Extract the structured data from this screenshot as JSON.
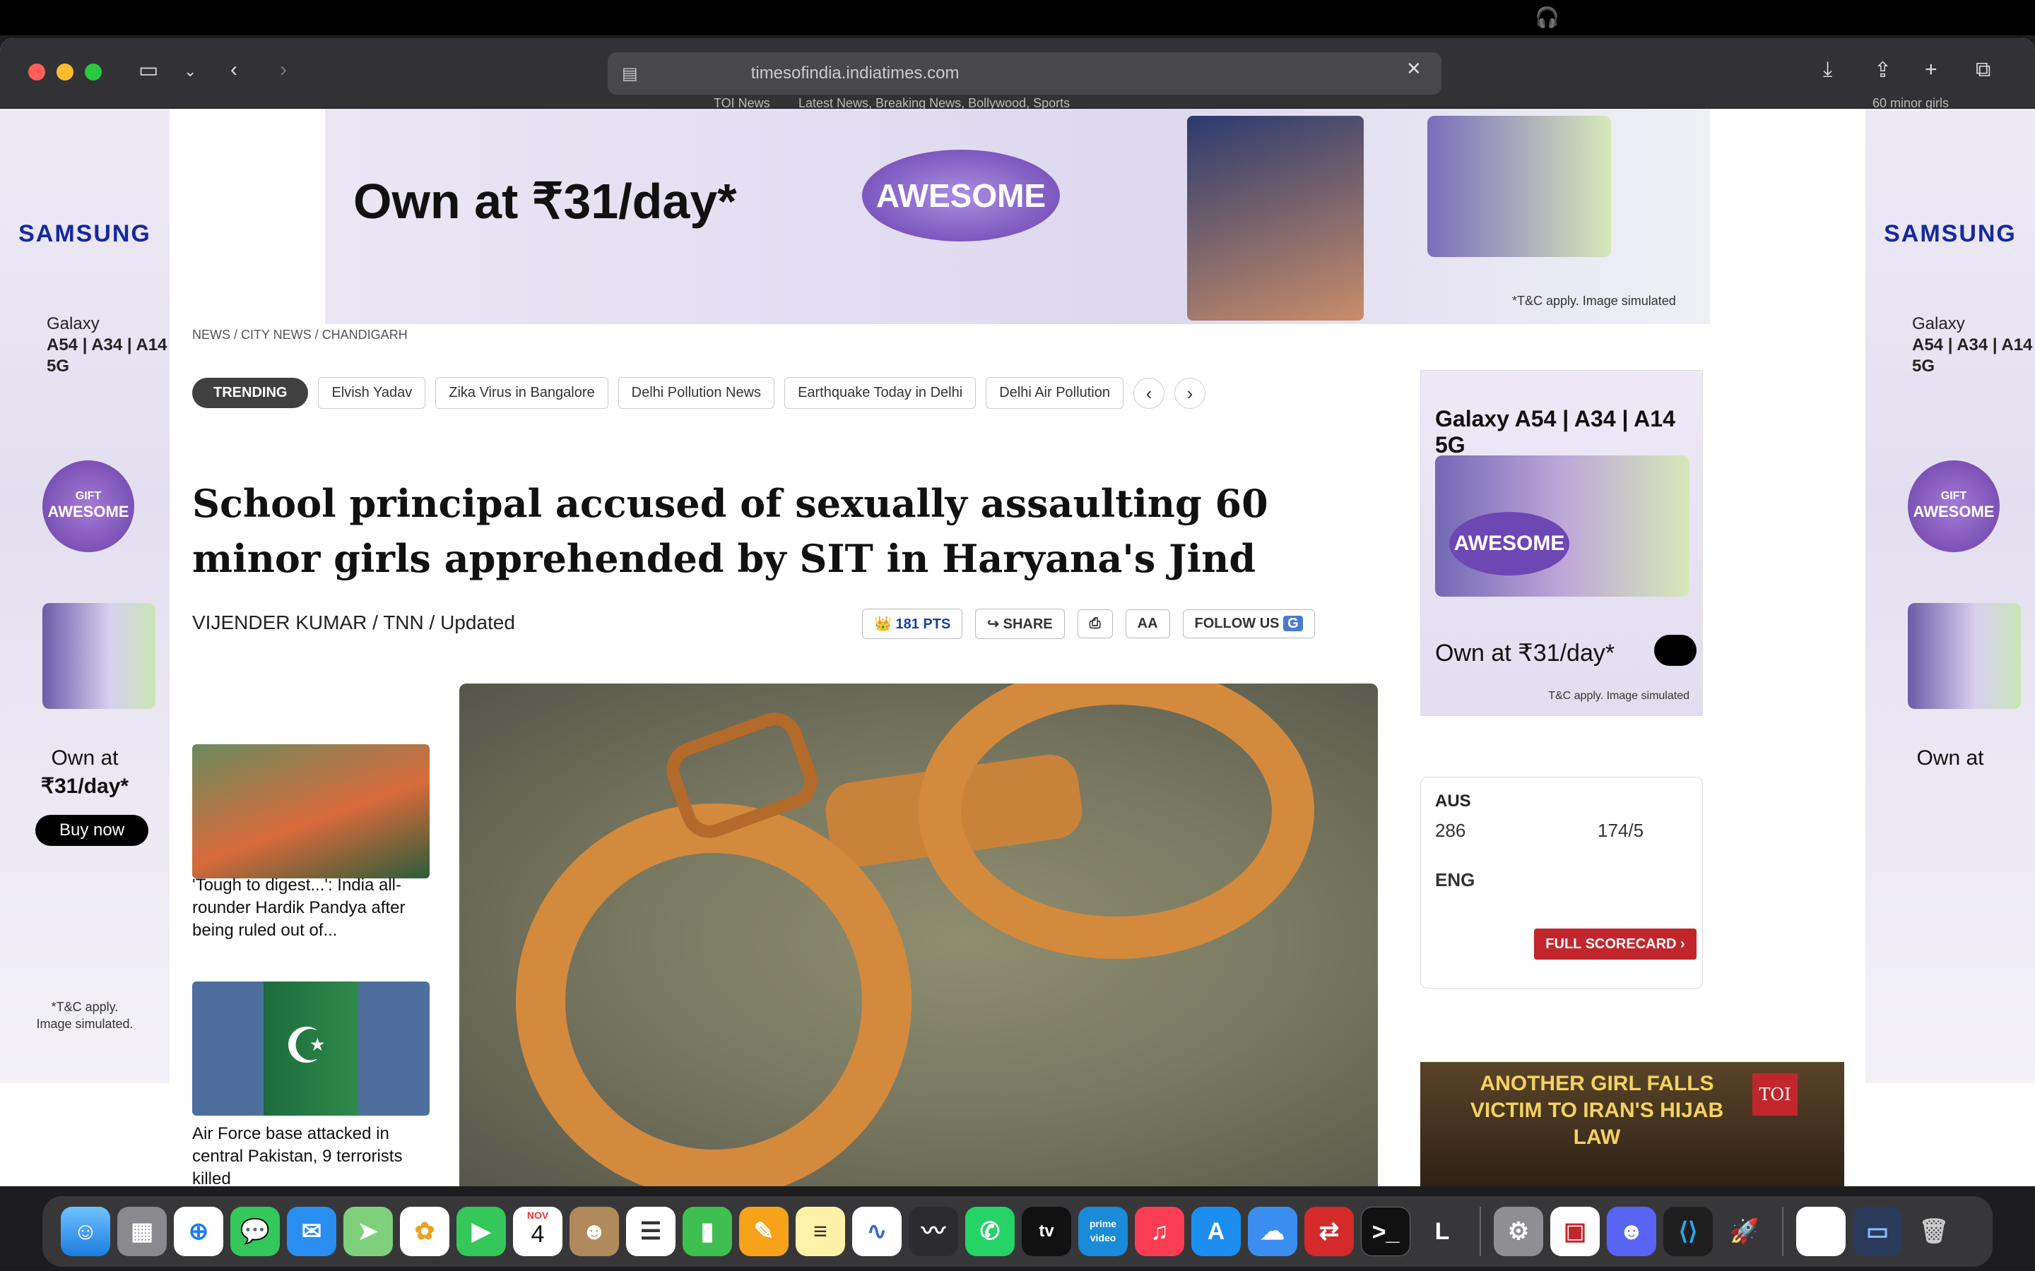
{
  "window": {
    "address": "timesofindia.indiatimes.com"
  },
  "tabs": [
    {
      "label": "TOI News"
    },
    {
      "label": "Latest News, Breaking News, Bollywood, Sports"
    },
    {
      "label": "60 minor girls"
    }
  ],
  "side_ad": {
    "brand": "SAMSUNG",
    "model_line1": "Galaxy",
    "model_line2": "A54 | A34 | A14 5G",
    "badge_line1": "GIFT",
    "badge_line2": "AWESOME",
    "own_line1": "Own at",
    "own_line2": "₹31/day*",
    "buy": "Buy now",
    "tc_line1": "*T&C apply.",
    "tc_line2": "Image simulated."
  },
  "banner": {
    "own": "Own at ₹31/day*",
    "awesome": "AWESOME",
    "tc": "*T&C apply. Image simulated"
  },
  "breadcrumb": "NEWS / CITY NEWS / CHANDIGARH",
  "trending": {
    "label": "TRENDING",
    "chips": [
      "Elvish Yadav",
      "Zika Virus in Bangalore",
      "Delhi Pollution News",
      "Earthquake Today in Delhi",
      "Delhi Air Pollution"
    ]
  },
  "article": {
    "headline": "School principal accused of sexually assaulting 60 minor girls apprehended by SIT in Haryana's Jind",
    "byline": "VIJENDER KUMAR / TNN / Updated",
    "points": "181 PTS",
    "share": "SHARE",
    "font_size": "AA",
    "follow": "FOLLOW US"
  },
  "rail": {
    "story1": "'Tough to digest...': India all-rounder Hardik Pandya after being ruled out of...",
    "story2": "Air Force base attacked in central Pakistan, 9 terrorists killed"
  },
  "right_ad": {
    "model": "Galaxy A54 | A34 | A14 5G",
    "awesome": "AWESOME",
    "own": "Own at ₹31/day*",
    "tc": "T&C apply. Image simulated"
  },
  "score": {
    "team1": "AUS",
    "score1": "286",
    "team2": "ENG",
    "score2": "174/5",
    "button": "FULL SCORECARD"
  },
  "video": {
    "title": "ANOTHER GIRL FALLS VICTIM TO IRAN'S HIJAB LAW",
    "logo": "TOI"
  },
  "dock": {
    "calendar_month": "NOV",
    "calendar_day": "4",
    "tv": "tv",
    "prime": "prime video",
    "letter": "L"
  }
}
